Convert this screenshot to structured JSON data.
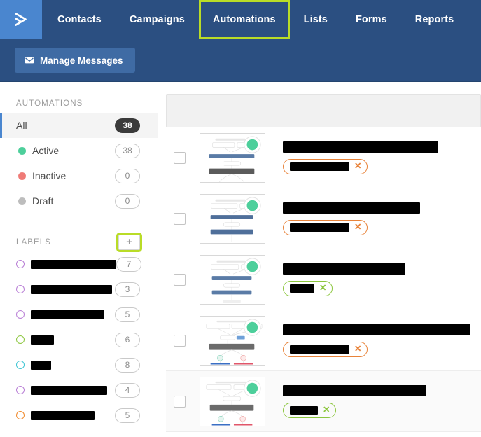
{
  "app": {
    "logo_icon": "activecampaign-chevron-icon",
    "accent_blue": "#4a86cf",
    "nav_bg": "#2b4f81",
    "highlight_color": "#b9dc27"
  },
  "topnav": {
    "items": [
      {
        "label": "Contacts",
        "highlighted": false
      },
      {
        "label": "Campaigns",
        "highlighted": false
      },
      {
        "label": "Automations",
        "highlighted": true
      },
      {
        "label": "Lists",
        "highlighted": false
      },
      {
        "label": "Forms",
        "highlighted": false
      },
      {
        "label": "Reports",
        "highlighted": false
      }
    ]
  },
  "subbar": {
    "manage_messages_label": "Manage Messages",
    "manage_messages_icon": "envelope-icon"
  },
  "sidebar": {
    "automations_heading": "AUTOMATIONS",
    "filters": [
      {
        "label": "All",
        "count": "38",
        "dot": "none",
        "active": true,
        "solid_badge": true
      },
      {
        "label": "Active",
        "count": "38",
        "dot": "#4dcf9b",
        "active": false,
        "solid_badge": false
      },
      {
        "label": "Inactive",
        "count": "0",
        "dot": "#ef7b77",
        "active": false,
        "solid_badge": false
      },
      {
        "label": "Draft",
        "count": "0",
        "dot": "#bdbdbd",
        "active": false,
        "solid_badge": false
      }
    ],
    "labels_heading": "LABELS",
    "add_label_icon": "plus-icon",
    "add_label_highlighted": true,
    "labels": [
      {
        "name": "",
        "redacted": true,
        "redact_width": 122,
        "ring_color": "#b97fd6",
        "count": "7"
      },
      {
        "name": "",
        "redacted": true,
        "redact_width": 116,
        "ring_color": "#b97fd6",
        "count": "3"
      },
      {
        "name": "",
        "redacted": true,
        "redact_width": 105,
        "ring_color": "#b97fd6",
        "count": "5"
      },
      {
        "name": "",
        "redacted": true,
        "redact_width": 33,
        "ring_color": "#8cc63e",
        "count": "6"
      },
      {
        "name": "",
        "redacted": true,
        "redact_width": 29,
        "ring_color": "#3fc6d4",
        "count": "8"
      },
      {
        "name": "",
        "redacted": true,
        "redact_width": 109,
        "ring_color": "#b97fd6",
        "count": "4"
      },
      {
        "name": "",
        "redacted": true,
        "redact_width": 91,
        "ring_color": "#f08a2c",
        "count": "5"
      }
    ]
  },
  "main": {
    "toolbar_empty": true,
    "rows": [
      {
        "checkbox_checked": false,
        "thumbnail_icon": "automation-workflow-thumbnail",
        "status_dot": "#4dcf9b",
        "title_redact_width": 222,
        "tag_redact_width": 85,
        "tag_color": "#e8833a",
        "tag_remove_icon": "close-icon",
        "hovered": false
      },
      {
        "checkbox_checked": false,
        "thumbnail_icon": "automation-workflow-thumbnail",
        "status_dot": "#4dcf9b",
        "title_redact_width": 196,
        "tag_redact_width": 85,
        "tag_color": "#e8833a",
        "tag_remove_icon": "close-icon",
        "hovered": false
      },
      {
        "checkbox_checked": false,
        "thumbnail_icon": "automation-workflow-thumbnail",
        "status_dot": "#4dcf9b",
        "title_redact_width": 175,
        "tag_redact_width": 35,
        "tag_color": "#8cc63e",
        "tag_remove_icon": "close-icon",
        "hovered": false
      },
      {
        "checkbox_checked": false,
        "thumbnail_icon": "automation-workflow-thumbnail",
        "status_dot": "#4dcf9b",
        "title_redact_width": 268,
        "tag_redact_width": 85,
        "tag_color": "#e8833a",
        "tag_remove_icon": "close-icon",
        "hovered": false
      },
      {
        "checkbox_checked": false,
        "thumbnail_icon": "automation-workflow-thumbnail",
        "status_dot": "#4dcf9b",
        "title_redact_width": 205,
        "tag_redact_width": 40,
        "tag_color": "#8cc63e",
        "tag_remove_icon": "close-icon",
        "hovered": true
      }
    ]
  }
}
